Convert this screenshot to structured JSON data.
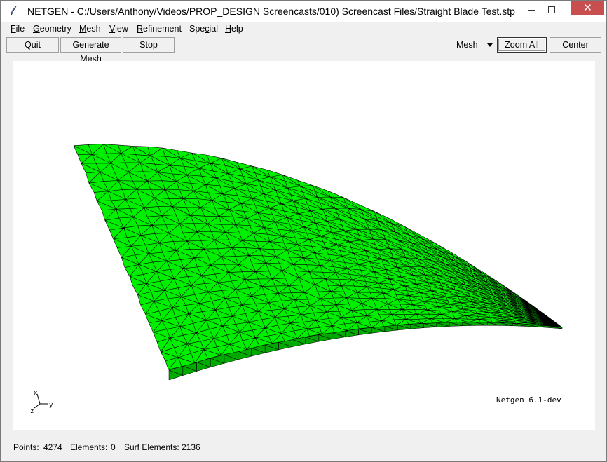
{
  "window": {
    "title": "NETGEN - C:/Users/Anthony/Videos/PROP_DESIGN Screencasts/010) Screencast Files/Straight Blade Test.stp",
    "icons": [
      "feather-icon",
      "minimize-icon",
      "maximize-icon",
      "close-icon"
    ],
    "close_glyph": "✕"
  },
  "menu": [
    {
      "label": "File",
      "u": "F",
      "rest": "ile"
    },
    {
      "label": "Geometry",
      "u": "G",
      "rest": "eometry"
    },
    {
      "label": "Mesh",
      "u": "M",
      "rest": "esh"
    },
    {
      "label": "View",
      "u": "V",
      "rest": "iew"
    },
    {
      "label": "Refinement",
      "u": "R",
      "rest": "efinement"
    },
    {
      "label": "Special",
      "pre": "Spe",
      "u": "c",
      "rest": "ial"
    },
    {
      "label": "Help",
      "u": "H",
      "rest": "elp"
    }
  ],
  "toolbar": {
    "quit": "Quit",
    "generate_mesh": "Generate Mesh",
    "stop": "Stop",
    "view_select": "Mesh",
    "zoom_all": "Zoom All",
    "center": "Center"
  },
  "viewport": {
    "version": "Netgen 6.1-dev",
    "axes": {
      "x": "x",
      "y": "y",
      "z": "z"
    },
    "mesh_color": "#00ee00",
    "mesh_shadow_color": "#00aa00",
    "edge_color": "#000000"
  },
  "status": {
    "points_label": "Points:",
    "points_value": "4274",
    "elements_label": "Elements:",
    "elements_value": "0",
    "surf_label": "Surf Elements:",
    "surf_value": "2136"
  }
}
